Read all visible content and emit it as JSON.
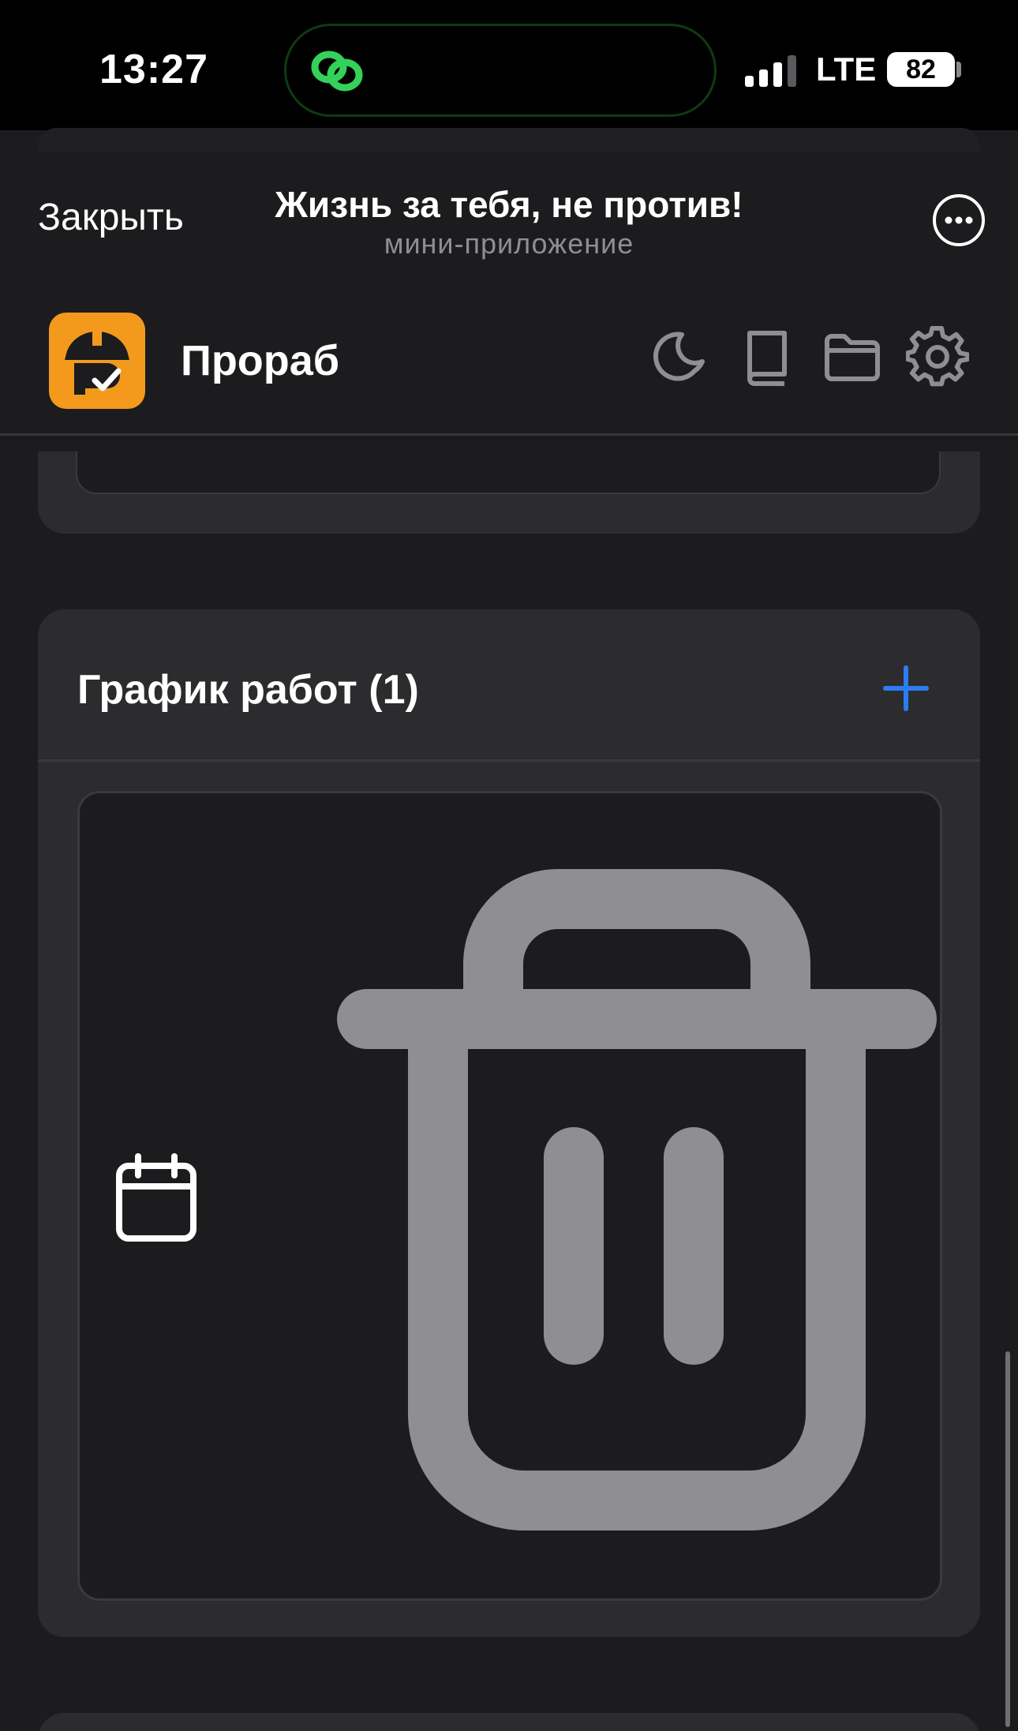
{
  "status_bar": {
    "time": "13:27",
    "network": "LTE",
    "battery": "82"
  },
  "header": {
    "close_label": "Закрыть",
    "title": "Жизнь за тебя, не против!",
    "subtitle": "мини-приложение",
    "more_icon": "ellipsis-circle-icon"
  },
  "app_bar": {
    "name": "Прораб",
    "logo_color": "#f39a1c",
    "icons": [
      "moon-icon",
      "book-icon",
      "folder-icon",
      "gear-icon"
    ]
  },
  "schedule": {
    "title": "График работ (1)",
    "add_icon": "plus-icon",
    "accent_color": "#2d7cf6",
    "entry": {
      "icon": "calendar-icon",
      "action_icon": "trash-icon"
    }
  },
  "colors": {
    "background": "#1c1c1e",
    "card": "#2c2c2e",
    "icon_gray": "#8e8e93"
  }
}
